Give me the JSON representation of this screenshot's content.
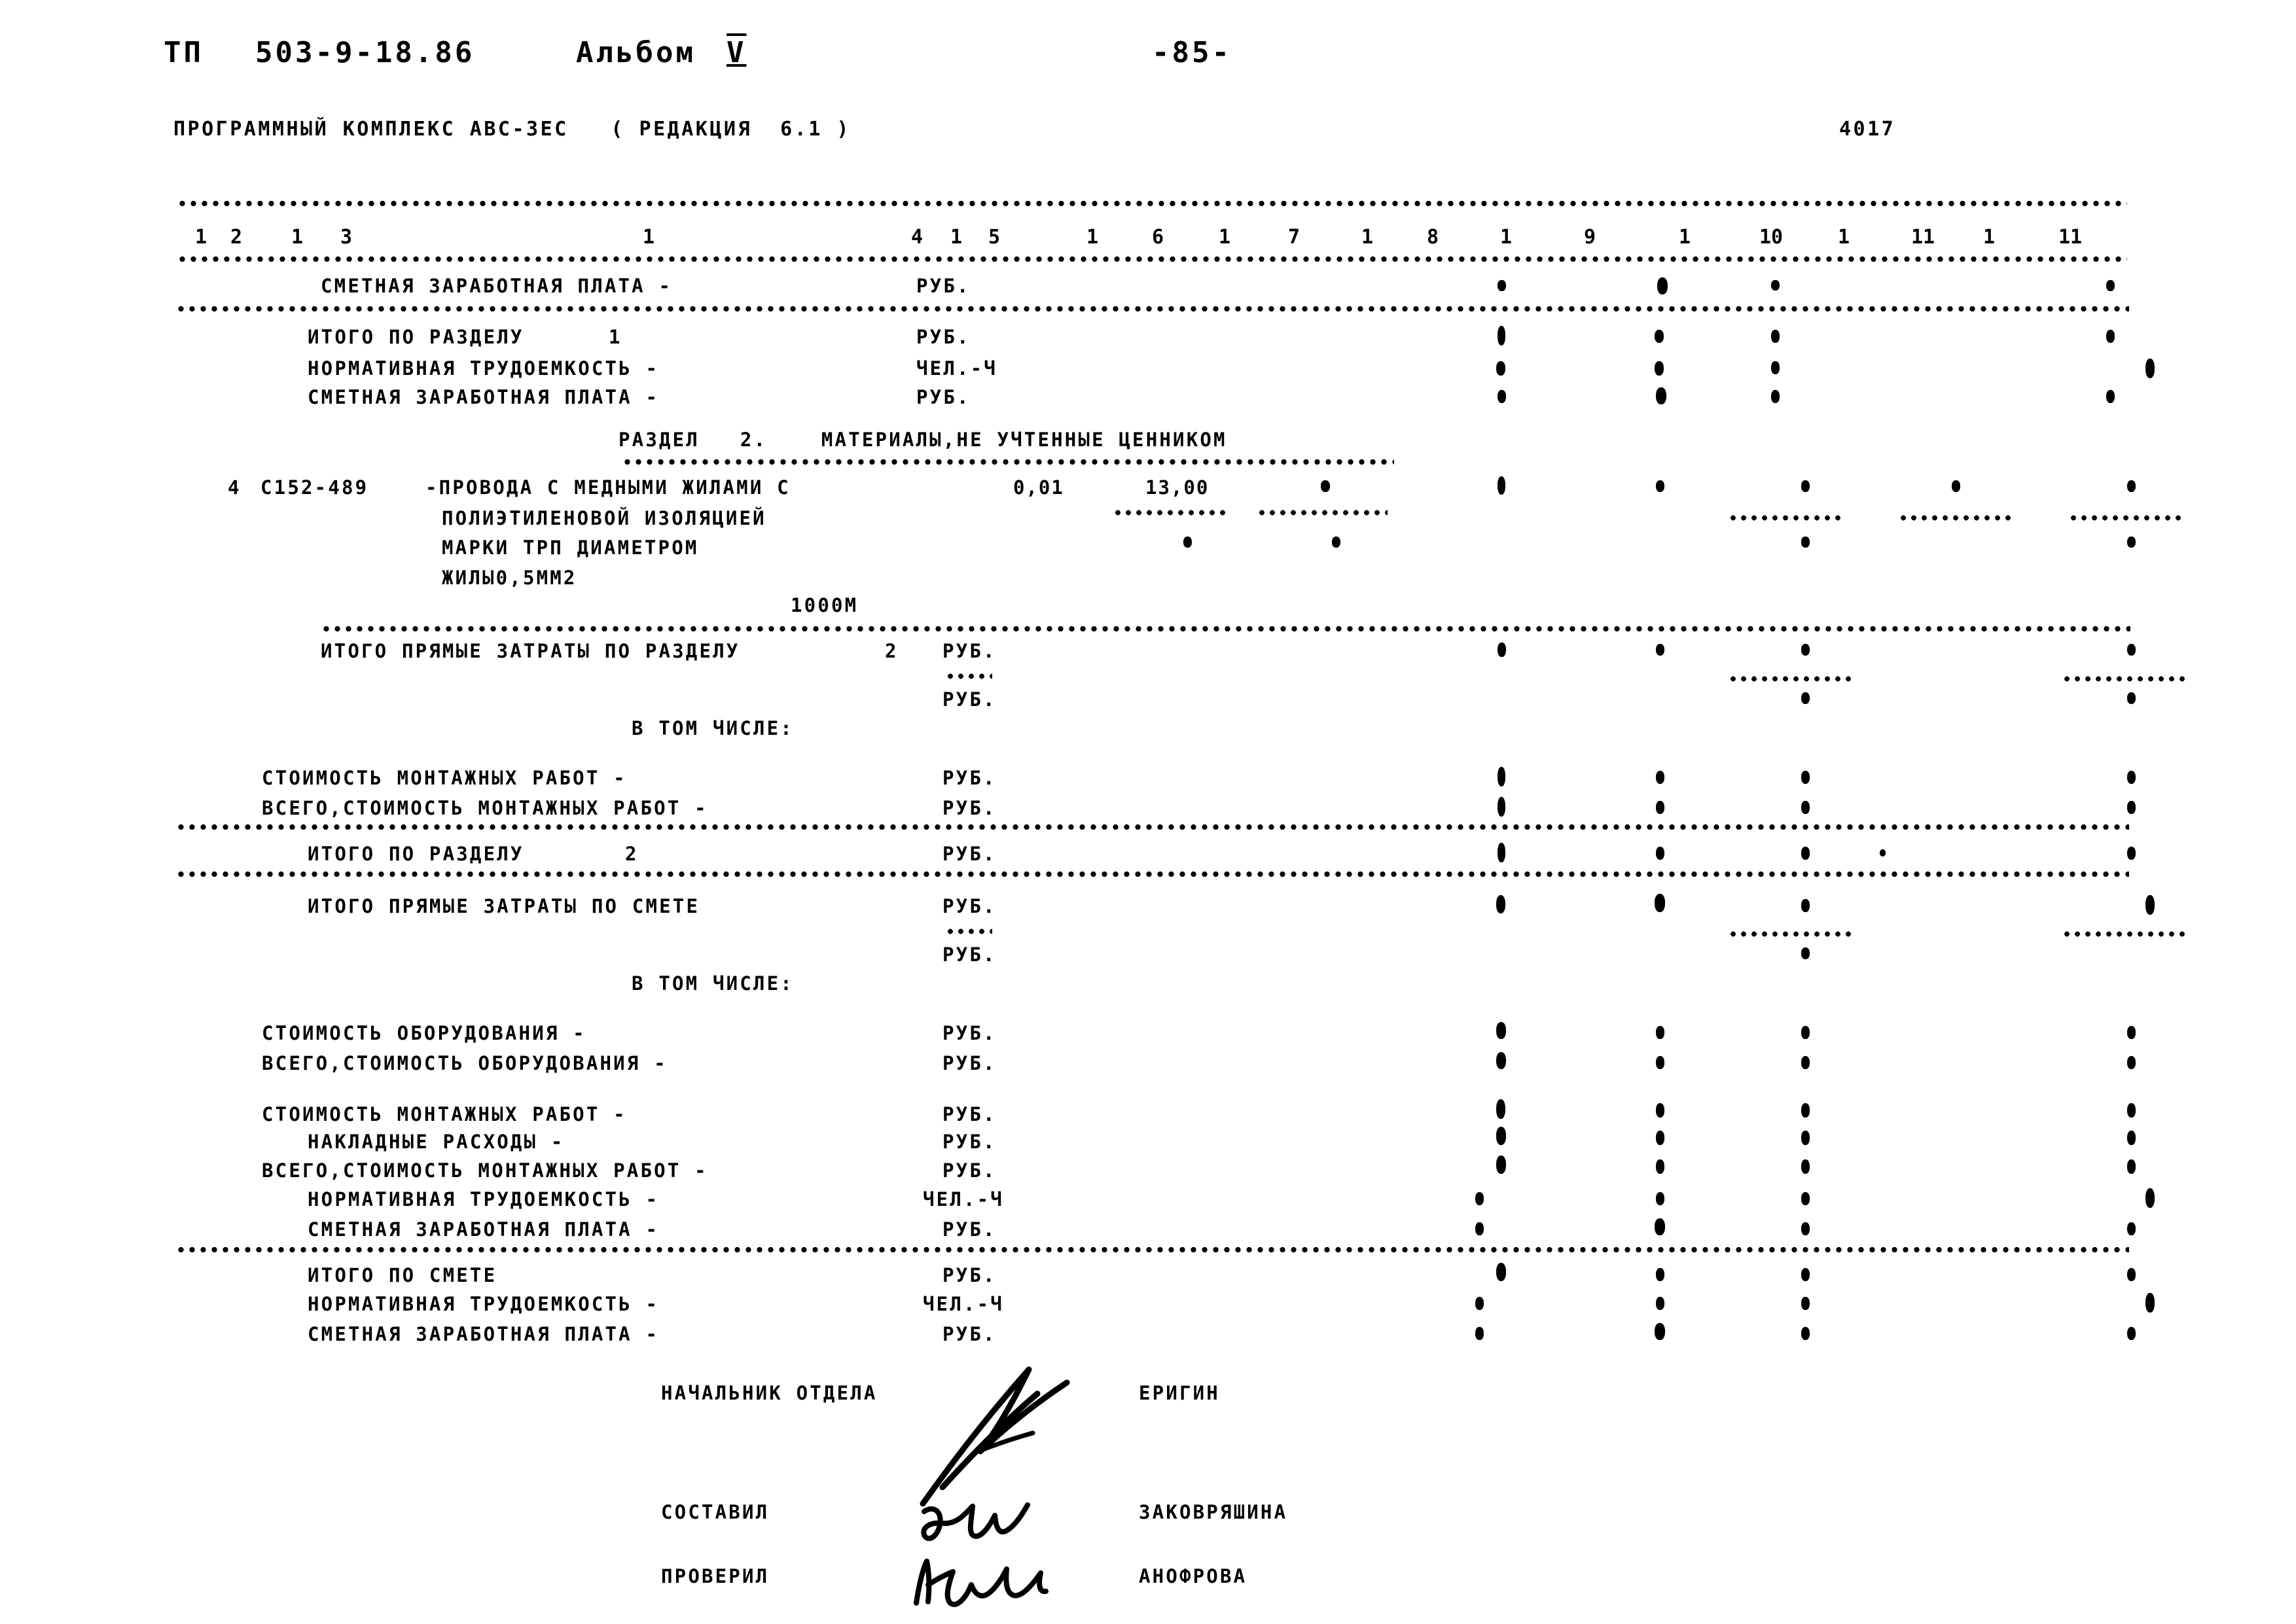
{
  "header": {
    "doc_code_prefix": "ТП",
    "doc_code": "503-9-18.86",
    "album_label": "Альбом",
    "album_number": "V",
    "page_number": "-85-",
    "program_line": "ПРОГРАММНЫЙ КОМПЛЕКС АВС-3ЕС   ( РЕДАКЦИЯ  6.1 )",
    "sheet_code": "4017"
  },
  "column_numbers": [
    "1",
    "2",
    "1",
    "3",
    "1",
    "4",
    "1",
    "5",
    "1",
    "6",
    "1",
    "7",
    "1",
    "8",
    "1",
    "9",
    "1",
    "10",
    "1",
    "11"
  ],
  "rows": [
    {
      "label": "СМЕТНАЯ ЗАРАБОТНАЯ ПЛАТА -",
      "unit": "РУБ."
    },
    {
      "label": "ИТОГО ПО РАЗДЕЛУ",
      "index": "1",
      "unit": "РУБ."
    },
    {
      "label": "НОРМАТИВНАЯ ТРУДОЕМКОСТЬ -",
      "unit": "ЧЕЛ.-Ч"
    },
    {
      "label": "СМЕТНАЯ ЗАРАБОТНАЯ ПЛАТА -",
      "unit": "РУБ."
    }
  ],
  "section": {
    "title": "РАЗДЕЛ   2.    МАТЕРИАЛЫ,НЕ УЧТЕННЫЕ ЦЕННИКОМ"
  },
  "item": {
    "pos": "4",
    "code": "С152-489",
    "desc_line1": "-ПРОВОДА С МЕДНЫМИ ЖИЛАМИ С",
    "desc_line2": "ПОЛИЭТИЛЕНОВОЙ ИЗОЛЯЦИЕЙ",
    "desc_line3": "МАРКИ ТРП ДИАМЕТРОМ",
    "desc_line4": "ЖИЛЫ0,5ММ2",
    "unit_qty": "1000М",
    "qty": "0,01",
    "price": "13,00"
  },
  "totals_section2": {
    "direct_costs_label": "ИТОГО ПРЯМЫЕ ЗАТРАТЫ ПО РАЗДЕЛУ",
    "direct_costs_index": "2",
    "unit_rub": "РУБ.",
    "unit_rub2": "РУБ.",
    "including_label": "В ТОМ ЧИСЛЕ:",
    "lines": [
      {
        "label": "СТОИМОСТЬ МОНТАЖНЫХ РАБОТ -",
        "unit": "РУБ."
      },
      {
        "label": "ВСЕГО,СТОИМОСТЬ МОНТАЖНЫХ РАБОТ -",
        "unit": "РУБ."
      }
    ],
    "section_total_label": "ИТОГО ПО РАЗДЕЛУ",
    "section_total_index": "2",
    "section_total_unit": "РУБ."
  },
  "totals_estimate": {
    "direct_costs_label": "ИТОГО ПРЯМЫЕ ЗАТРАТЫ ПО СМЕТЕ",
    "unit_rub": "РУБ.",
    "unit_rub2": "РУБ.",
    "including_label": "В ТОМ ЧИСЛЕ:",
    "lines": [
      {
        "label": "СТОИМОСТЬ ОБОРУДОВАНИЯ -",
        "unit": "РУБ."
      },
      {
        "label": "ВСЕГО,СТОИМОСТЬ ОБОРУДОВАНИЯ -",
        "unit": "РУБ."
      },
      {
        "label": "СТОИМОСТЬ МОНТАЖНЫХ РАБОТ -",
        "unit": "РУБ."
      },
      {
        "label": "НАКЛАДНЫЕ РАСХОДЫ -",
        "unit": "РУБ."
      },
      {
        "label": "ВСЕГО,СТОИМОСТЬ МОНТАЖНЫХ РАБОТ -",
        "unit": "РУБ."
      },
      {
        "label": "НОРМАТИВНАЯ ТРУДОЕМКОСТЬ -",
        "unit": "ЧЕЛ.-Ч"
      },
      {
        "label": "СМЕТНАЯ ЗАРАБОТНАЯ ПЛАТА -",
        "unit": "РУБ."
      }
    ],
    "grand_total_label": "ИТОГО ПО СМЕТЕ",
    "grand_total_unit": "РУБ.",
    "labor_label": "НОРМАТИВНАЯ ТРУДОЕМКОСТЬ -",
    "labor_unit": "ЧЕЛ.-Ч",
    "wages_label": "СМЕТНАЯ ЗАРАБОТНАЯ ПЛАТА -",
    "wages_unit": "РУБ."
  },
  "signatures": [
    {
      "role": "НАЧАЛЬНИК ОТДЕЛА",
      "name": "ЕРИГИН"
    },
    {
      "role": "СОСТАВИЛ",
      "name": "ЗАКОВРЯШИНА"
    },
    {
      "role": "ПРОВЕРИЛ",
      "name": "АНОФРОВА"
    }
  ]
}
